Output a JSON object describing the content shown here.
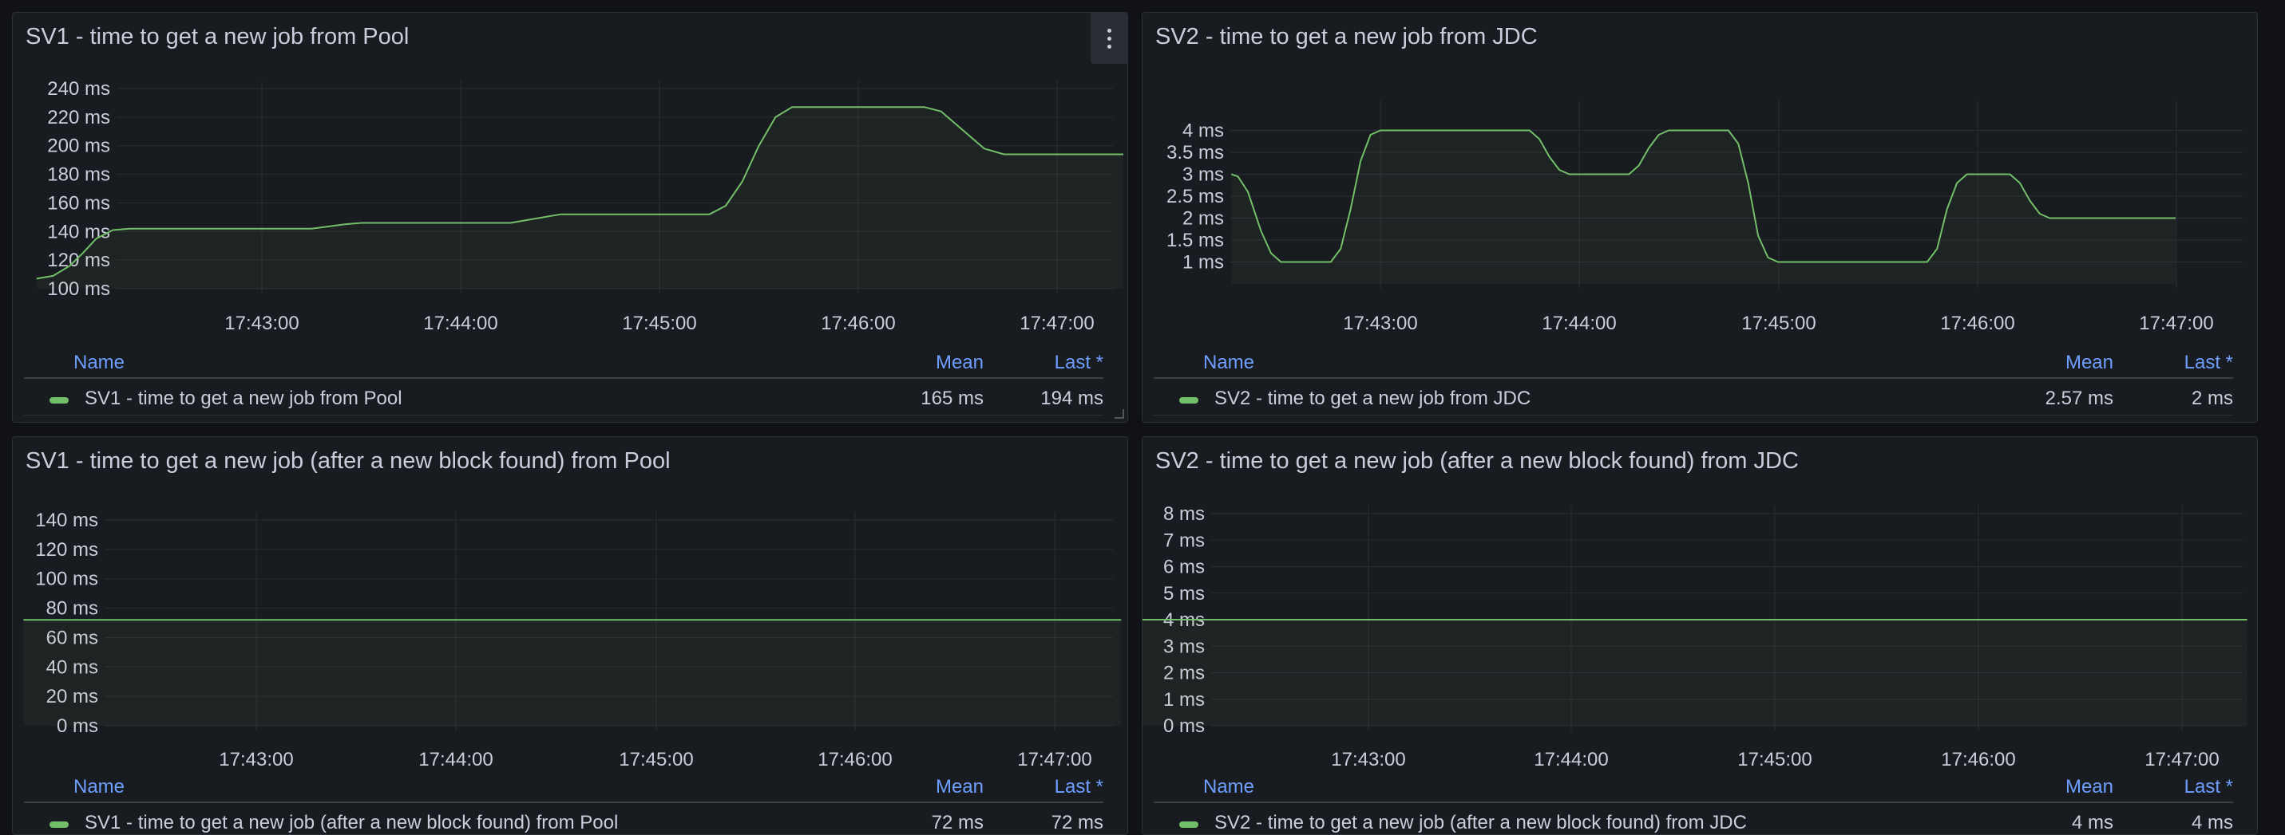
{
  "colors": {
    "series": "#73bf69",
    "grid": "#2a2d33",
    "axis_text": "#ccccdc",
    "legend_header": "#6e9fff",
    "panel_bg": "#181b1f"
  },
  "legend_headers": {
    "name": "Name",
    "mean": "Mean",
    "last": "Last *"
  },
  "menu_icon": "kebab-menu-icon",
  "chart_data": [
    {
      "type": "area",
      "title": "SV1 - time to get a new job from Pool",
      "x_ticks": [
        "17:43:00",
        "17:44:00",
        "17:45:00",
        "17:46:00",
        "17:47:00"
      ],
      "y_ticks": [
        "240 ms",
        "220 ms",
        "200 ms",
        "180 ms",
        "160 ms",
        "140 ms",
        "120 ms",
        "100 ms"
      ],
      "ylim": [
        100,
        240
      ],
      "x_range_sec": [
        -70,
        210
      ],
      "grid": true,
      "series": [
        {
          "name": "SV1 - time to get a new job from Pool",
          "mean": "165 ms",
          "last": "194 ms",
          "points": [
            [
              -68,
              107
            ],
            [
              -63,
              109
            ],
            [
              -58,
              116
            ],
            [
              -54,
              125
            ],
            [
              -50,
              135
            ],
            [
              -45,
              141
            ],
            [
              -40,
              142
            ],
            [
              15,
              142
            ],
            [
              25,
              145
            ],
            [
              30,
              146
            ],
            [
              75,
              146
            ],
            [
              85,
              150
            ],
            [
              90,
              152
            ],
            [
              135,
              152
            ],
            [
              140,
              158
            ],
            [
              145,
              175
            ],
            [
              150,
              200
            ],
            [
              155,
              220
            ],
            [
              160,
              227
            ],
            [
              195,
              227
            ],
            [
              200,
              227
            ],
            [
              205,
              224
            ],
            [
              212,
              210
            ],
            [
              218,
              198
            ],
            [
              224,
              194
            ],
            [
              260,
              194
            ]
          ]
        }
      ]
    },
    {
      "type": "area",
      "title": "SV2 - time to get a new job from JDC",
      "x_ticks": [
        "17:43:00",
        "17:44:00",
        "17:45:00",
        "17:46:00",
        "17:47:00"
      ],
      "y_ticks": [
        "4 ms",
        "3.5 ms",
        "3 ms",
        "2.5 ms",
        "2 ms",
        "1.5 ms",
        "1 ms"
      ],
      "ylim": [
        0.5,
        4.5
      ],
      "grid": true,
      "series": [
        {
          "name": "SV2 - time to get a new job from JDC",
          "mean": "2.57 ms",
          "last": "2 ms",
          "points": [
            [
              -45,
              3
            ],
            [
              -43,
              2.95
            ],
            [
              -40,
              2.6
            ],
            [
              -36,
              1.7
            ],
            [
              -33,
              1.2
            ],
            [
              -30,
              1
            ],
            [
              -15,
              1
            ],
            [
              -12,
              1.3
            ],
            [
              -9,
              2.2
            ],
            [
              -6,
              3.3
            ],
            [
              -3,
              3.9
            ],
            [
              0,
              4
            ],
            [
              45,
              4
            ],
            [
              48,
              3.8
            ],
            [
              51,
              3.4
            ],
            [
              54,
              3.1
            ],
            [
              57,
              3
            ],
            [
              75,
              3
            ],
            [
              78,
              3.2
            ],
            [
              81,
              3.6
            ],
            [
              84,
              3.9
            ],
            [
              87,
              4
            ],
            [
              105,
              4
            ],
            [
              108,
              3.7
            ],
            [
              111,
              2.8
            ],
            [
              114,
              1.6
            ],
            [
              117,
              1.1
            ],
            [
              120,
              1
            ],
            [
              165,
              1
            ],
            [
              168,
              1.3
            ],
            [
              171,
              2.2
            ],
            [
              174,
              2.8
            ],
            [
              177,
              3
            ],
            [
              190,
              3
            ],
            [
              193,
              2.8
            ],
            [
              196,
              2.4
            ],
            [
              199,
              2.1
            ],
            [
              202,
              2
            ],
            [
              240,
              2
            ]
          ]
        }
      ]
    },
    {
      "type": "area",
      "title": "SV1 - time to get a new job (after a new block found) from Pool",
      "x_ticks": [
        "17:43:00",
        "17:44:00",
        "17:45:00",
        "17:46:00",
        "17:47:00"
      ],
      "y_ticks": [
        "140 ms",
        "120 ms",
        "100 ms",
        "80 ms",
        "60 ms",
        "40 ms",
        "20 ms",
        "0 ms"
      ],
      "ylim": [
        0,
        140
      ],
      "grid": true,
      "series": [
        {
          "name": "SV1 - time to get a new job (after a new block found) from Pool",
          "mean": "72 ms",
          "last": "72 ms",
          "points": [
            [
              -70,
              72
            ],
            [
              260,
              72
            ]
          ]
        }
      ]
    },
    {
      "type": "area",
      "title": "SV2 - time to get a new job (after a new block found) from JDC",
      "x_ticks": [
        "17:43:00",
        "17:44:00",
        "17:45:00",
        "17:46:00",
        "17:47:00"
      ],
      "y_ticks": [
        "8 ms",
        "7 ms",
        "6 ms",
        "5 ms",
        "4 ms",
        "3 ms",
        "2 ms",
        "1 ms",
        "0 ms"
      ],
      "ylim": [
        0,
        8
      ],
      "grid": true,
      "series": [
        {
          "name": "SV2 - time to get a new job (after a new block found) from JDC",
          "mean": "4 ms",
          "last": "4 ms",
          "points": [
            [
              -70,
              4
            ],
            [
              260,
              4
            ]
          ]
        }
      ]
    }
  ]
}
